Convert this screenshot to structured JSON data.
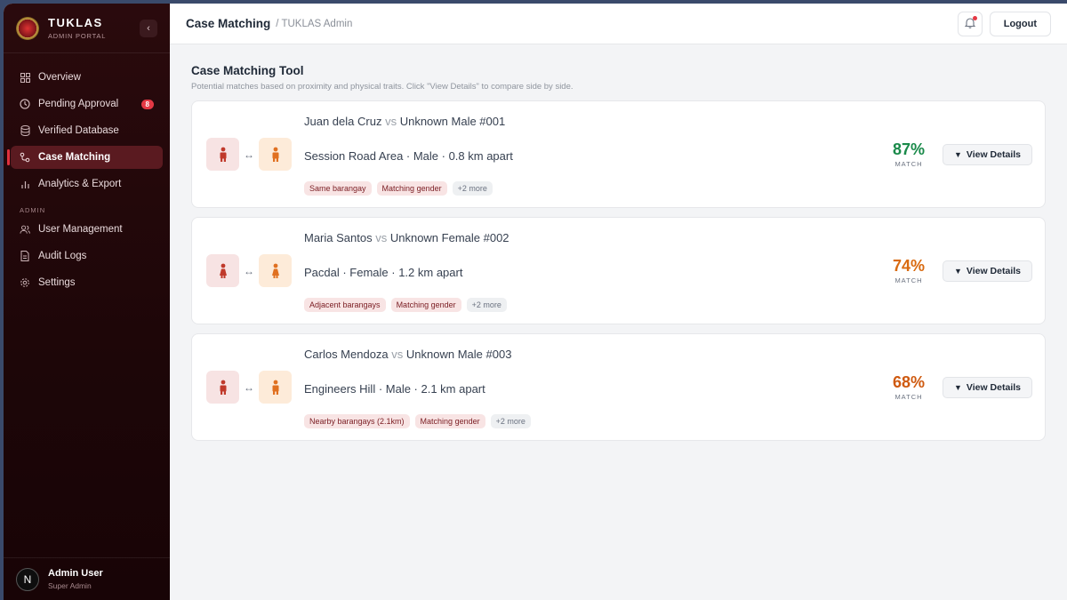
{
  "brand": {
    "name": "TUKLAS",
    "subtitle": "ADMIN PORTAL"
  },
  "sidebar": {
    "collapse_icon": "‹",
    "items": [
      {
        "label": "Overview",
        "icon": "grid-icon"
      },
      {
        "label": "Pending Approval",
        "icon": "clock-icon",
        "badge": "8"
      },
      {
        "label": "Verified Database",
        "icon": "database-icon"
      },
      {
        "label": "Case Matching",
        "icon": "match-icon",
        "active": true
      },
      {
        "label": "Analytics & Export",
        "icon": "chart-icon"
      }
    ],
    "admin_section": "ADMIN",
    "admin_items": [
      {
        "label": "User Management",
        "icon": "users-icon"
      },
      {
        "label": "Audit Logs",
        "icon": "file-icon"
      },
      {
        "label": "Settings",
        "icon": "gear-icon"
      }
    ]
  },
  "user": {
    "initial": "N",
    "name": "Admin User",
    "role": "Super Admin"
  },
  "header": {
    "title": "Case Matching",
    "subtitle": "/ TUKLAS Admin",
    "logout": "Logout"
  },
  "page": {
    "title": "Case Matching Tool",
    "description": "Potential matches based on proximity and physical traits. Click \"View Details\" to compare side by side."
  },
  "matches": [
    {
      "missing": "Juan dela Cruz",
      "vs": "vs",
      "found": "Unknown Male #001",
      "detail": "Session Road Area · Male · 0.8 km apart",
      "tags": [
        "Same barangay",
        "Matching gender"
      ],
      "more": "+2 more",
      "percent": "87%",
      "match_label": "MATCH",
      "color": "#1a8a4a",
      "view": "View Details",
      "found_color": "#e07020"
    },
    {
      "missing": "Maria Santos",
      "vs": "vs",
      "found": "Unknown Female #002",
      "detail": "Pacdal · Female · 1.2 km apart",
      "tags": [
        "Adjacent barangays",
        "Matching gender"
      ],
      "more": "+2 more",
      "percent": "74%",
      "match_label": "MATCH",
      "color": "#d96a10",
      "view": "View Details"
    },
    {
      "missing": "Carlos Mendoza",
      "vs": "vs",
      "found": "Unknown Male #003",
      "detail": "Engineers Hill · Male · 2.1 km apart",
      "tags": [
        "Nearby barangays (2.1km)",
        "Matching gender"
      ],
      "more": "+2 more",
      "percent": "68%",
      "match_label": "MATCH",
      "color": "#cf5a10",
      "view": "View Details"
    }
  ]
}
